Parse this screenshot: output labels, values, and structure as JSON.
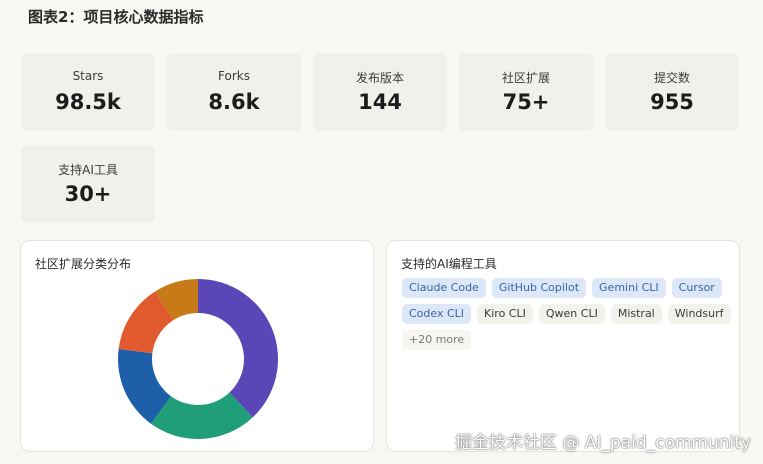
{
  "figure": {
    "title": "图表2：项目核心数据指标"
  },
  "stats": [
    {
      "label": "Stars",
      "value": "98.5k"
    },
    {
      "label": "Forks",
      "value": "8.6k"
    },
    {
      "label": "发布版本",
      "value": "144"
    },
    {
      "label": "社区扩展",
      "value": "75+"
    },
    {
      "label": "提交数",
      "value": "955"
    },
    {
      "label": "支持AI工具",
      "value": "30+"
    }
  ],
  "more_menu": "···",
  "donut_panel": {
    "title": "社区扩展分类分布"
  },
  "chart_data": {
    "type": "pie",
    "title": "社区扩展分类分布",
    "hole": true,
    "slices": [
      {
        "value": 38,
        "color": "#5b46b8"
      },
      {
        "value": 22,
        "color": "#1f9e78"
      },
      {
        "value": 17,
        "color": "#1d5fa8"
      },
      {
        "value": 14,
        "color": "#e05a2e"
      },
      {
        "value": 9,
        "color": "#c87a18"
      }
    ]
  },
  "tools_panel": {
    "title": "支持的AI编程工具",
    "tags": [
      {
        "label": "Claude Code",
        "style": "blue"
      },
      {
        "label": "GitHub Copilot",
        "style": "blue"
      },
      {
        "label": "Gemini CLI",
        "style": "blue"
      },
      {
        "label": "Cursor",
        "style": "blue"
      },
      {
        "label": "Codex CLI",
        "style": "blue"
      },
      {
        "label": "Kiro CLI",
        "style": "gray"
      },
      {
        "label": "Qwen CLI",
        "style": "gray"
      },
      {
        "label": "Mistral",
        "style": "gray"
      },
      {
        "label": "Windsurf",
        "style": "gray"
      },
      {
        "label": "+20 more",
        "style": "more"
      }
    ]
  },
  "watermark": "掘金技术社区 @ AI_paid_community"
}
